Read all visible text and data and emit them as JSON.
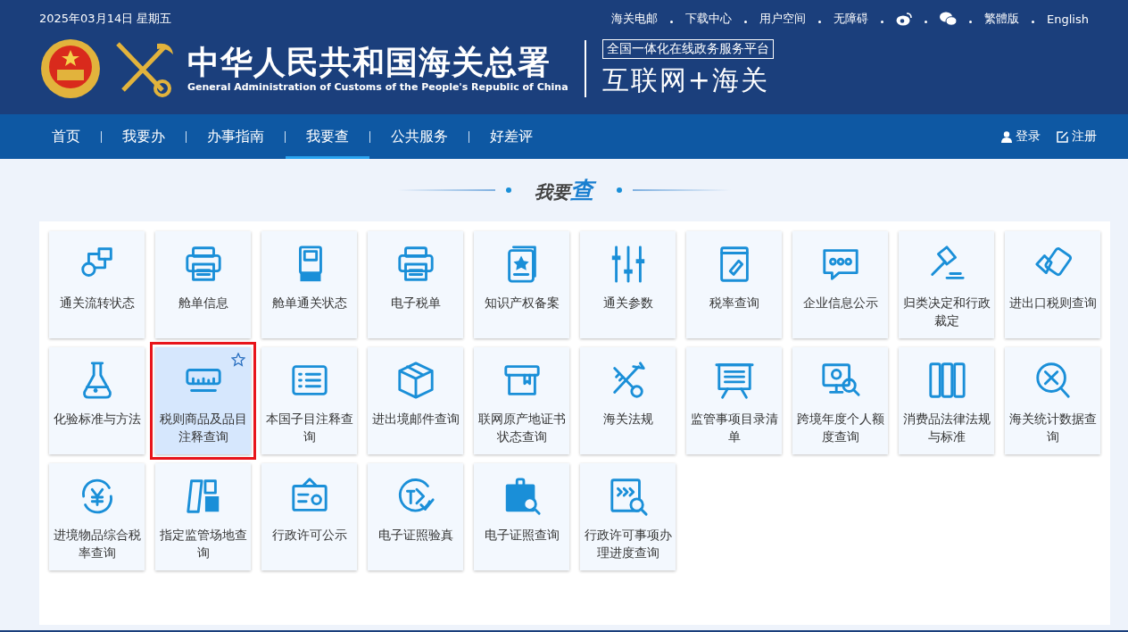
{
  "header": {
    "date": "2025年03月14日 星期五",
    "top_links": [
      {
        "kind": "text",
        "label": "海关电邮"
      },
      {
        "kind": "text",
        "label": "下载中心"
      },
      {
        "kind": "text",
        "label": "用户空间"
      },
      {
        "kind": "text",
        "label": "无障碍"
      },
      {
        "kind": "weibo"
      },
      {
        "kind": "wechat"
      },
      {
        "kind": "text",
        "label": "繁體版"
      },
      {
        "kind": "text",
        "label": "English"
      }
    ],
    "title_cn": "中华人民共和国海关总署",
    "title_en": "General Administration of Customs of the People's Republic of China",
    "platform": "全国一体化在线政务服务平台",
    "slogan": "互联网+海关"
  },
  "nav": {
    "items": [
      {
        "label": "首页",
        "selected": false
      },
      {
        "label": "我要办",
        "selected": false
      },
      {
        "label": "办事指南",
        "selected": false
      },
      {
        "label": "我要查",
        "selected": true
      },
      {
        "label": "公共服务",
        "selected": false
      },
      {
        "label": "好差评",
        "selected": false
      }
    ],
    "login": "登录",
    "register": "注册"
  },
  "section": {
    "title": "我要**查**"
  },
  "tiles": [
    {
      "label": "通关流转状态",
      "selected": false
    },
    {
      "label": "舱单信息",
      "selected": false
    },
    {
      "label": "舱单通关状态",
      "selected": false
    },
    {
      "label": "电子税单",
      "selected": false
    },
    {
      "label": "知识产权备案",
      "selected": false
    },
    {
      "label": "通关参数",
      "selected": false
    },
    {
      "label": "税率查询",
      "selected": false
    },
    {
      "label": "企业信息公示",
      "selected": false
    },
    {
      "label": "归类决定和行政裁定",
      "selected": false
    },
    {
      "label": "进出口税则查询",
      "selected": false
    },
    {
      "label": "化验标准与方法",
      "selected": false
    },
    {
      "label": "税则商品及品目注释查询",
      "selected": true
    },
    {
      "label": "本国子目注释查询",
      "selected": false
    },
    {
      "label": "进出境邮件查询",
      "selected": false
    },
    {
      "label": "联网原产地证书状态查询",
      "selected": false
    },
    {
      "label": "海关法规",
      "selected": false
    },
    {
      "label": "监管事项目录清单",
      "selected": false
    },
    {
      "label": "跨境年度个人额度查询",
      "selected": false
    },
    {
      "label": "消费品法律法规与标准",
      "selected": false
    },
    {
      "label": "海关统计数据查询",
      "selected": false
    },
    {
      "label": "进境物品综合税率查询",
      "selected": false
    },
    {
      "label": "指定监管场地查询",
      "selected": false
    },
    {
      "label": "行政许可公示",
      "selected": false
    },
    {
      "label": "电子证照验真",
      "selected": false
    },
    {
      "label": "电子证照查询",
      "selected": false
    },
    {
      "label": "行政许可事项办理进度查询",
      "selected": false
    }
  ]
}
